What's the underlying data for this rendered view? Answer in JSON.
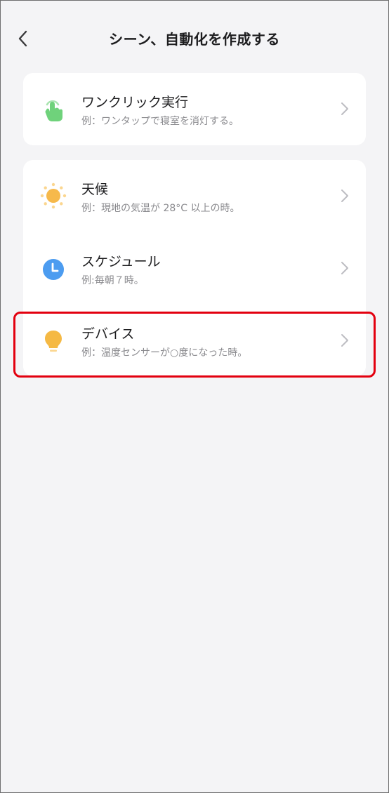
{
  "header": {
    "title": "シーン、自動化を作成する",
    "back_icon": "chevron-left-icon"
  },
  "one_click": {
    "title": "ワンクリック実行",
    "subtitle": "例：ワンタップで寝室を消灯する。",
    "icon": "tap-hand-icon",
    "icon_color": "#6fd27b"
  },
  "conditions": [
    {
      "title": "天候",
      "subtitle": "例：現地の気温が 28°C 以上の時。",
      "icon": "sun-icon",
      "icon_color": "#f6b94b"
    },
    {
      "title": "スケジュール",
      "subtitle": "例:毎朝７時。",
      "icon": "clock-icon",
      "icon_color": "#4c9cf0"
    },
    {
      "title": "デバイス",
      "subtitle": "例：温度センサーが○度になった時。",
      "icon": "lightbulb-icon",
      "icon_color": "#f5b944"
    }
  ],
  "colors": {
    "background": "#f4f4f6",
    "card": "#ffffff",
    "highlight": "#e3000f",
    "text": "#1d1d1f",
    "subtext": "#8a8a8e"
  }
}
